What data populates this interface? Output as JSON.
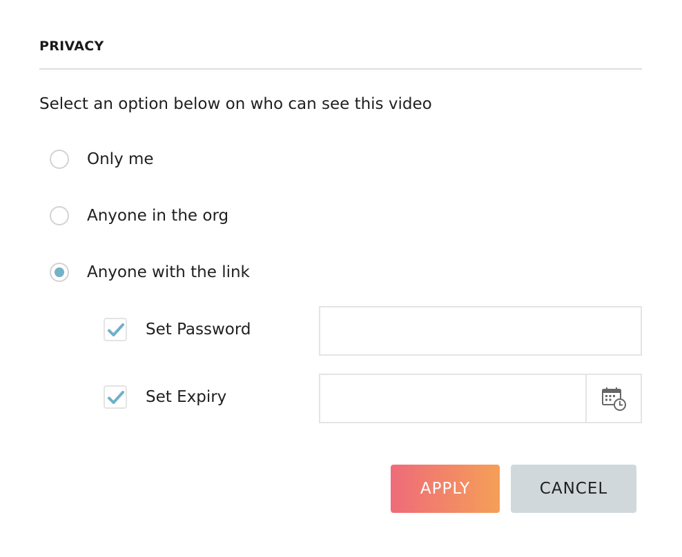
{
  "section": {
    "title": "PRIVACY",
    "prompt": "Select an option below on who can see this video"
  },
  "privacy_options": [
    {
      "label": "Only me",
      "selected": false
    },
    {
      "label": "Anyone in the org",
      "selected": false
    },
    {
      "label": "Anyone with the link",
      "selected": true
    }
  ],
  "link_settings": {
    "password": {
      "label": "Set Password",
      "checked": true,
      "value": "",
      "placeholder": ""
    },
    "expiry": {
      "label": "Set Expiry",
      "checked": true,
      "value": "",
      "placeholder": "",
      "icon": "calendar-clock-icon"
    }
  },
  "actions": {
    "apply_label": "APPLY",
    "cancel_label": "CANCEL"
  },
  "colors": {
    "accent": "#73b2c9",
    "checkmark": "#6fb0c8",
    "apply_gradient_start": "#ee6b79",
    "apply_gradient_end": "#f59f58",
    "cancel_bg": "#d0d8dc",
    "border": "#e4e4e4"
  }
}
